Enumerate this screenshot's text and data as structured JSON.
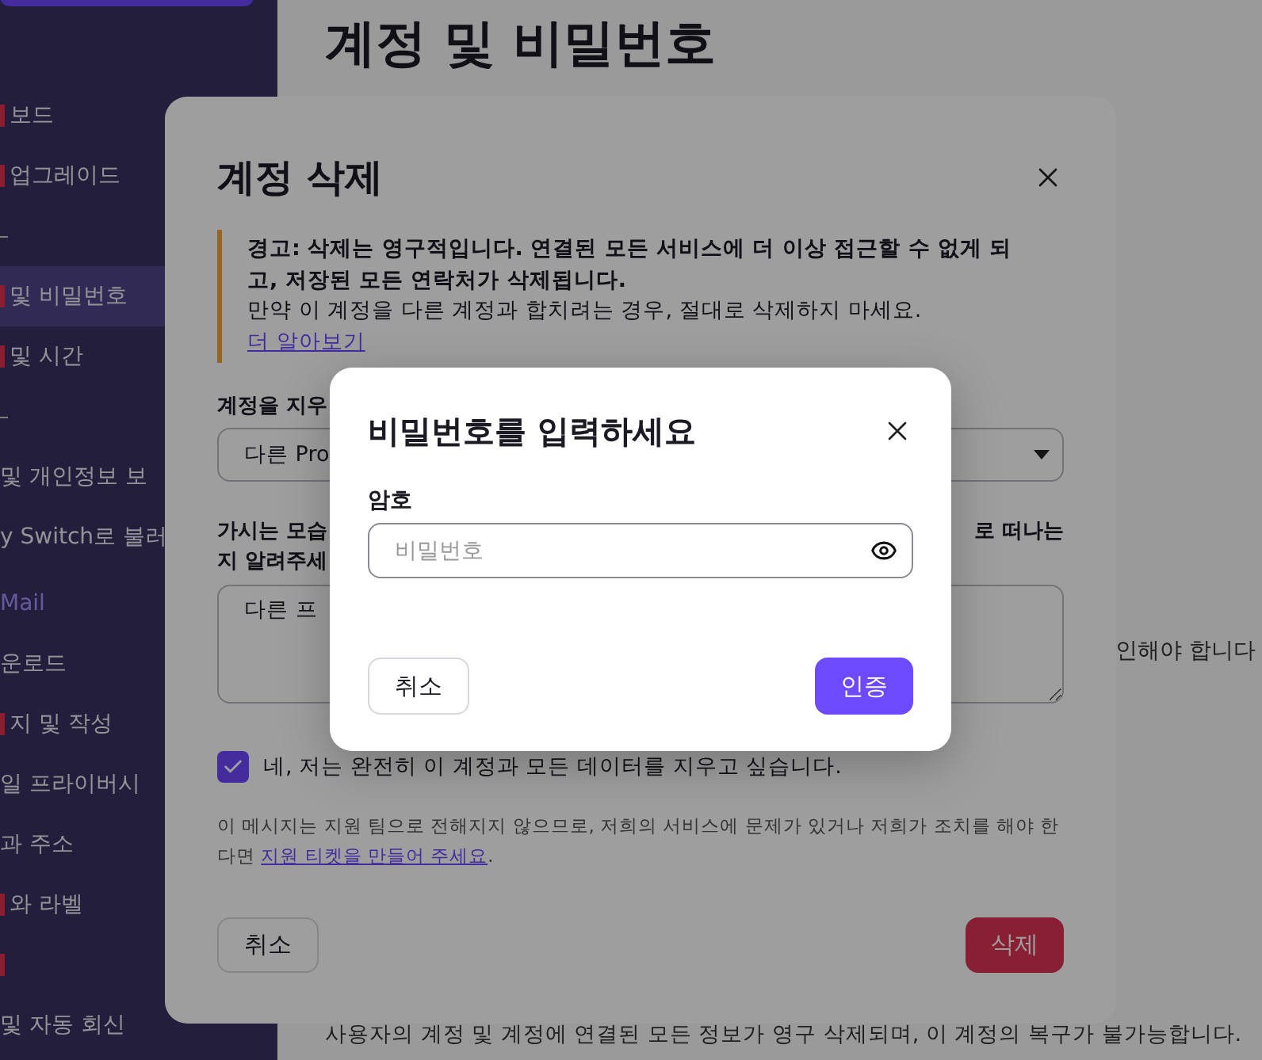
{
  "sidebar": {
    "items": [
      {
        "kind": "item",
        "label": "보드",
        "flag": true,
        "selected": false
      },
      {
        "kind": "item",
        "label": "업그레이드",
        "flag": true,
        "selected": false
      },
      {
        "kind": "mark"
      },
      {
        "kind": "item",
        "label": "및 비밀번호",
        "flag": true,
        "selected": true
      },
      {
        "kind": "item",
        "label": "및 시간",
        "flag": true,
        "selected": false
      },
      {
        "kind": "mark"
      },
      {
        "kind": "item",
        "label": "및 개인정보 보",
        "flag": false,
        "selected": false
      },
      {
        "kind": "item",
        "label": "y Switch로 불러",
        "flag": false,
        "selected": false
      },
      {
        "kind": "section",
        "label": "Mail"
      },
      {
        "kind": "item",
        "label": "운로드",
        "flag": false,
        "selected": false
      },
      {
        "kind": "item",
        "label": "지 및 작성",
        "flag": true,
        "selected": false
      },
      {
        "kind": "item",
        "label": "일 프라이버시",
        "flag": false,
        "selected": false
      },
      {
        "kind": "item",
        "label": "과 주소",
        "flag": false,
        "selected": false
      },
      {
        "kind": "item",
        "label": "와 라벨",
        "flag": true,
        "selected": false
      },
      {
        "kind": "item",
        "flag": true,
        "selected": false
      },
      {
        "kind": "item",
        "label": "및 자동 회신",
        "flag": false,
        "selected": false
      }
    ]
  },
  "main": {
    "title": "계정 및 비밀번호",
    "notice_fragment": "인해야 합니다",
    "footer_text": "사용자의 계정 및 계정에 연결된 모든 정보가 영구 삭제되며, 이 계정의 복구가 불가능합니다."
  },
  "delete_dialog": {
    "title": "계정 삭제",
    "warning": {
      "bold_text": "경고: 삭제는 영구적입니다. 연결된 모든 서비스에 더 이상 접근할 수 없게 되고, 저장된 모든 연락처가 삭제됩니다.",
      "text": "만약 이 계정을 다른 계정과 합치려는 경우, 절대로 삭제하지 마세요.",
      "link": "더 알아보기"
    },
    "reason_label": "계정을 지우",
    "reason_select": {
      "value": "다른 Pro"
    },
    "feedback_label": {
      "left_lines": [
        "가시는 모습",
        "지 알려주세"
      ],
      "right": "로 떠나는"
    },
    "feedback": {
      "value": "다른 프"
    },
    "confirm": {
      "label": "네, 저는 완전히 이 계정과 모든 데이터를 지우고 싶습니다.",
      "checked": true
    },
    "note": {
      "text": "이 메시지는 지원 팀으로 전해지지 않으므로, 저희의 서비스에 문제가 있거나 저희가 조치를 해야 한다면 ",
      "link": "지원 티켓을 만들어 주세요",
      "end": "."
    },
    "buttons": {
      "cancel": "취소",
      "delete": "삭제"
    }
  },
  "password_dialog": {
    "title": "비밀번호를 입력하세요",
    "field_label": "암호",
    "password": {
      "placeholder": "비밀번호"
    },
    "buttons": {
      "cancel": "취소",
      "confirm": "인증"
    }
  }
}
